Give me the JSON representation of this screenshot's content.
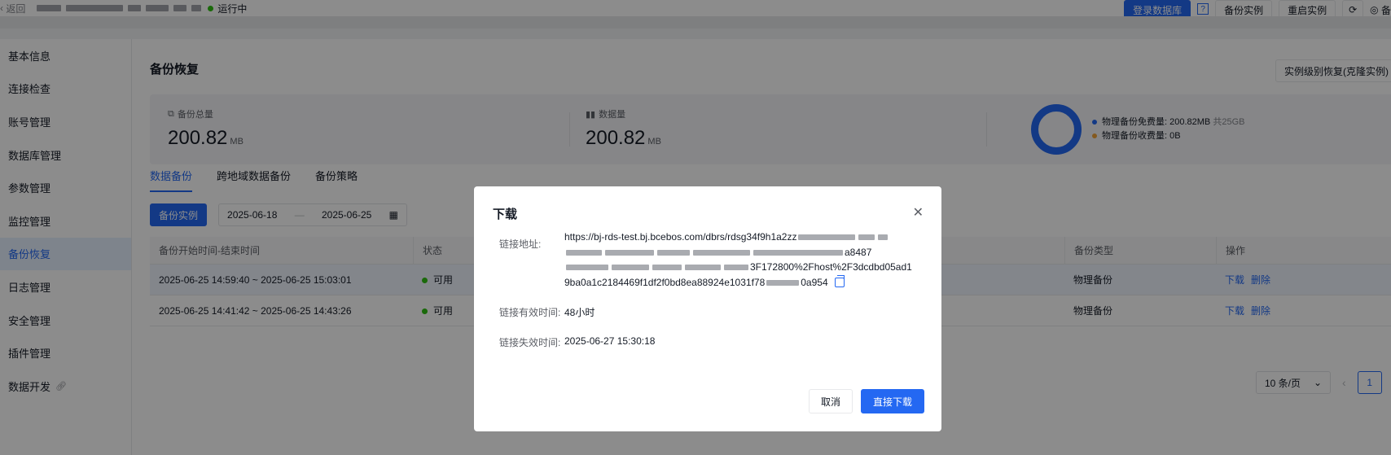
{
  "header": {
    "back_label": "返回",
    "instance_status": "运行中",
    "actions": {
      "login_db": "登录数据库",
      "help": "?",
      "backup_instance": "备份实例",
      "restart_instance": "重启实例",
      "more": "备"
    }
  },
  "sidebar": {
    "items": [
      {
        "label": "基本信息"
      },
      {
        "label": "连接检查"
      },
      {
        "label": "账号管理"
      },
      {
        "label": "数据库管理"
      },
      {
        "label": "参数管理"
      },
      {
        "label": "监控管理"
      },
      {
        "label": "备份恢复"
      },
      {
        "label": "日志管理"
      },
      {
        "label": "安全管理"
      },
      {
        "label": "插件管理"
      },
      {
        "label": "数据开发"
      }
    ]
  },
  "main": {
    "title": "备份恢复",
    "clone_button": "实例级别恢复(克隆实例)",
    "stats": {
      "total_label": "备份总量",
      "total_value": "200.82",
      "total_unit": "MB",
      "data_label": "数据量",
      "data_value": "200.82",
      "data_unit": "MB",
      "legend": [
        {
          "label": "物理备份免费量:",
          "value": "200.82MB",
          "extra": "共25GB",
          "color": "#2468f2"
        },
        {
          "label": "物理备份收费量:",
          "value": "0B",
          "extra": "",
          "color": "#f0a33a"
        }
      ]
    },
    "tabs": [
      {
        "label": "数据备份"
      },
      {
        "label": "跨地域数据备份"
      },
      {
        "label": "备份策略"
      }
    ],
    "toolbar": {
      "backup_button": "备份实例",
      "date_start": "2025-06-18",
      "date_sep": "—",
      "date_end": "2025-06-25"
    },
    "table": {
      "columns": [
        "备份开始时间-结束时间",
        "状态",
        "备份类型",
        "操作"
      ],
      "rows": [
        {
          "time": "2025-06-25 14:59:40 ~ 2025-06-25 15:03:01",
          "status": "可用",
          "type": "物理备份",
          "op1": "下载",
          "op2": "删除"
        },
        {
          "time": "2025-06-25 14:41:42 ~ 2025-06-25 14:43:26",
          "status": "可用",
          "type": "物理备份",
          "op1": "下载",
          "op2": "删除"
        }
      ]
    },
    "pager": {
      "page_size": "10 条/页",
      "current_page": "1"
    }
  },
  "modal": {
    "title": "下载",
    "url_label": "链接地址:",
    "url_line1": "https://bj-rds-test.bj.bcebos.com/dbrs/rdsg34f9h1a2zz",
    "url_line2_tail": "a8487",
    "url_line3_tail": "3F172800%2Fhost%2F3dcdbd05ad1",
    "url_line4_start": "9ba0a1c2184469f1df2f0bd8ea88924e1031f78",
    "url_line4_end": "0a954",
    "valid_label": "链接有效时间:",
    "valid_value": "48小时",
    "expire_label": "链接失效时间:",
    "expire_value": "2025-06-27 15:30:18",
    "cancel": "取消",
    "download": "直接下载"
  }
}
